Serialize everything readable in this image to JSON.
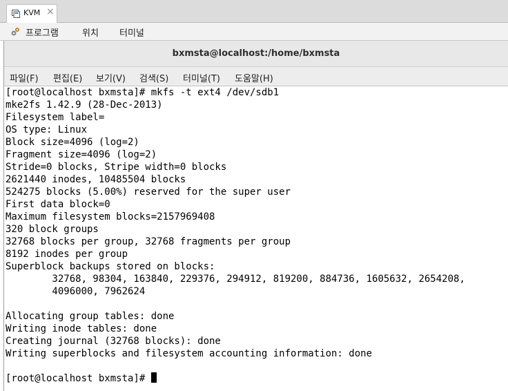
{
  "outer_tab": {
    "label": "KVM",
    "close": "×"
  },
  "panel": {
    "items": [
      "프로그램",
      "위치",
      "터미널"
    ]
  },
  "window": {
    "title": "bxmsta@localhost:/home/bxmsta",
    "menu": [
      "파일(F)",
      "편집(E)",
      "보기(V)",
      "검색(S)",
      "터미널(T)",
      "도움말(H)"
    ]
  },
  "terminal": {
    "lines": [
      "[root@localhost bxmsta]# mkfs -t ext4 /dev/sdb1",
      "mke2fs 1.42.9 (28-Dec-2013)",
      "Filesystem label=",
      "OS type: Linux",
      "Block size=4096 (log=2)",
      "Fragment size=4096 (log=2)",
      "Stride=0 blocks, Stripe width=0 blocks",
      "2621440 inodes, 10485504 blocks",
      "524275 blocks (5.00%) reserved for the super user",
      "First data block=0",
      "Maximum filesystem blocks=2157969408",
      "320 block groups",
      "32768 blocks per group, 32768 fragments per group",
      "8192 inodes per group",
      "Superblock backups stored on blocks:",
      "        32768, 98304, 163840, 229376, 294912, 819200, 884736, 1605632, 2654208,",
      "        4096000, 7962624",
      "",
      "Allocating group tables: done",
      "Writing inode tables: done",
      "Creating journal (32768 blocks): done",
      "Writing superblocks and filesystem accounting information: done",
      "",
      "[root@localhost bxmsta]# "
    ]
  }
}
